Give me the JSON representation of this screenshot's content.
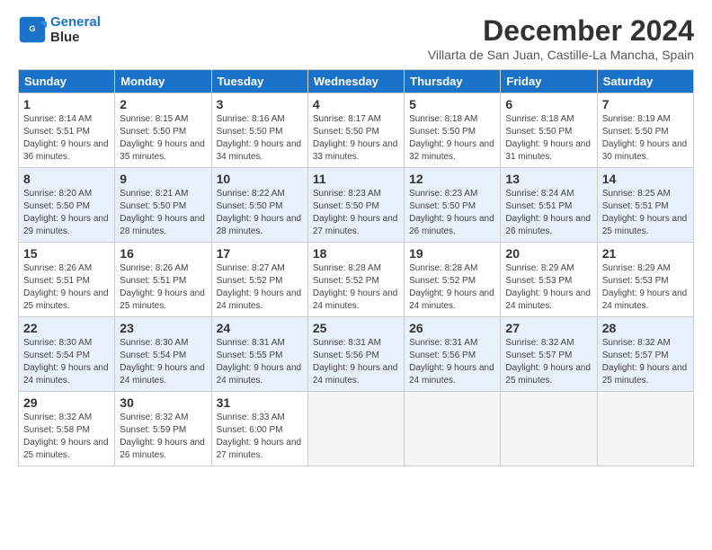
{
  "logo": {
    "line1": "General",
    "line2": "Blue"
  },
  "title": "December 2024",
  "subtitle": "Villarta de San Juan, Castille-La Mancha, Spain",
  "weekdays": [
    "Sunday",
    "Monday",
    "Tuesday",
    "Wednesday",
    "Thursday",
    "Friday",
    "Saturday"
  ],
  "weeks": [
    [
      {
        "day": "1",
        "sunrise": "8:14 AM",
        "sunset": "5:51 PM",
        "daylight": "9 hours and 36 minutes."
      },
      {
        "day": "2",
        "sunrise": "8:15 AM",
        "sunset": "5:50 PM",
        "daylight": "9 hours and 35 minutes."
      },
      {
        "day": "3",
        "sunrise": "8:16 AM",
        "sunset": "5:50 PM",
        "daylight": "9 hours and 34 minutes."
      },
      {
        "day": "4",
        "sunrise": "8:17 AM",
        "sunset": "5:50 PM",
        "daylight": "9 hours and 33 minutes."
      },
      {
        "day": "5",
        "sunrise": "8:18 AM",
        "sunset": "5:50 PM",
        "daylight": "9 hours and 32 minutes."
      },
      {
        "day": "6",
        "sunrise": "8:18 AM",
        "sunset": "5:50 PM",
        "daylight": "9 hours and 31 minutes."
      },
      {
        "day": "7",
        "sunrise": "8:19 AM",
        "sunset": "5:50 PM",
        "daylight": "9 hours and 30 minutes."
      }
    ],
    [
      {
        "day": "8",
        "sunrise": "8:20 AM",
        "sunset": "5:50 PM",
        "daylight": "9 hours and 29 minutes."
      },
      {
        "day": "9",
        "sunrise": "8:21 AM",
        "sunset": "5:50 PM",
        "daylight": "9 hours and 28 minutes."
      },
      {
        "day": "10",
        "sunrise": "8:22 AM",
        "sunset": "5:50 PM",
        "daylight": "9 hours and 28 minutes."
      },
      {
        "day": "11",
        "sunrise": "8:23 AM",
        "sunset": "5:50 PM",
        "daylight": "9 hours and 27 minutes."
      },
      {
        "day": "12",
        "sunrise": "8:23 AM",
        "sunset": "5:50 PM",
        "daylight": "9 hours and 26 minutes."
      },
      {
        "day": "13",
        "sunrise": "8:24 AM",
        "sunset": "5:51 PM",
        "daylight": "9 hours and 26 minutes."
      },
      {
        "day": "14",
        "sunrise": "8:25 AM",
        "sunset": "5:51 PM",
        "daylight": "9 hours and 25 minutes."
      }
    ],
    [
      {
        "day": "15",
        "sunrise": "8:26 AM",
        "sunset": "5:51 PM",
        "daylight": "9 hours and 25 minutes."
      },
      {
        "day": "16",
        "sunrise": "8:26 AM",
        "sunset": "5:51 PM",
        "daylight": "9 hours and 25 minutes."
      },
      {
        "day": "17",
        "sunrise": "8:27 AM",
        "sunset": "5:52 PM",
        "daylight": "9 hours and 24 minutes."
      },
      {
        "day": "18",
        "sunrise": "8:28 AM",
        "sunset": "5:52 PM",
        "daylight": "9 hours and 24 minutes."
      },
      {
        "day": "19",
        "sunrise": "8:28 AM",
        "sunset": "5:52 PM",
        "daylight": "9 hours and 24 minutes."
      },
      {
        "day": "20",
        "sunrise": "8:29 AM",
        "sunset": "5:53 PM",
        "daylight": "9 hours and 24 minutes."
      },
      {
        "day": "21",
        "sunrise": "8:29 AM",
        "sunset": "5:53 PM",
        "daylight": "9 hours and 24 minutes."
      }
    ],
    [
      {
        "day": "22",
        "sunrise": "8:30 AM",
        "sunset": "5:54 PM",
        "daylight": "9 hours and 24 minutes."
      },
      {
        "day": "23",
        "sunrise": "8:30 AM",
        "sunset": "5:54 PM",
        "daylight": "9 hours and 24 minutes."
      },
      {
        "day": "24",
        "sunrise": "8:31 AM",
        "sunset": "5:55 PM",
        "daylight": "9 hours and 24 minutes."
      },
      {
        "day": "25",
        "sunrise": "8:31 AM",
        "sunset": "5:56 PM",
        "daylight": "9 hours and 24 minutes."
      },
      {
        "day": "26",
        "sunrise": "8:31 AM",
        "sunset": "5:56 PM",
        "daylight": "9 hours and 24 minutes."
      },
      {
        "day": "27",
        "sunrise": "8:32 AM",
        "sunset": "5:57 PM",
        "daylight": "9 hours and 25 minutes."
      },
      {
        "day": "28",
        "sunrise": "8:32 AM",
        "sunset": "5:57 PM",
        "daylight": "9 hours and 25 minutes."
      }
    ],
    [
      {
        "day": "29",
        "sunrise": "8:32 AM",
        "sunset": "5:58 PM",
        "daylight": "9 hours and 25 minutes."
      },
      {
        "day": "30",
        "sunrise": "8:32 AM",
        "sunset": "5:59 PM",
        "daylight": "9 hours and 26 minutes."
      },
      {
        "day": "31",
        "sunrise": "8:33 AM",
        "sunset": "6:00 PM",
        "daylight": "9 hours and 27 minutes."
      },
      null,
      null,
      null,
      null
    ]
  ]
}
